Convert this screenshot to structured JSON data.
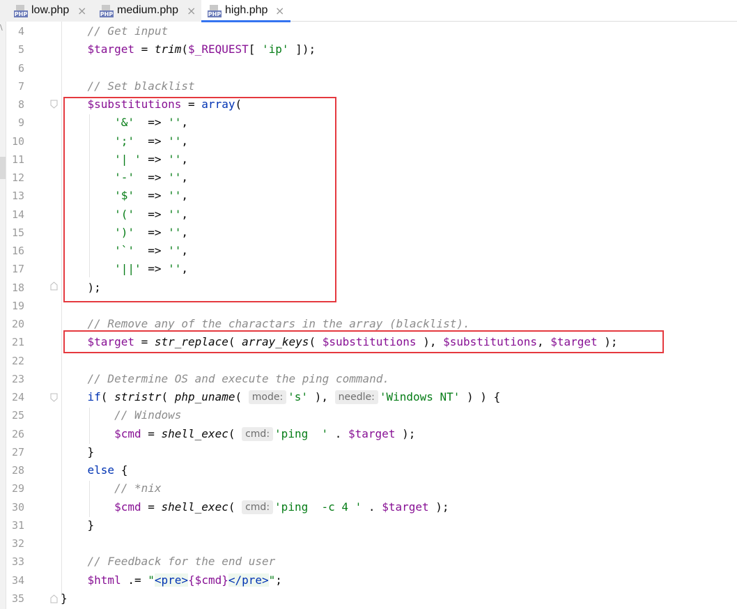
{
  "tabs": [
    {
      "label": "low.php",
      "icon": "php-file-icon",
      "active": false
    },
    {
      "label": "medium.php",
      "icon": "php-file-icon",
      "active": false
    },
    {
      "label": "high.php",
      "icon": "php-file-icon",
      "active": true
    }
  ],
  "php_icon_text": "PHP",
  "close_glyph": "×",
  "gutter_corner_text": "\\",
  "line_numbers": [
    "4",
    "5",
    "6",
    "7",
    "8",
    "9",
    "10",
    "11",
    "12",
    "13",
    "14",
    "15",
    "16",
    "17",
    "18",
    "19",
    "20",
    "21",
    "22",
    "23",
    "24",
    "25",
    "26",
    "27",
    "28",
    "29",
    "30",
    "31",
    "32",
    "33",
    "34",
    "35"
  ],
  "code": {
    "l4_comment": "// Get input",
    "l5": {
      "var": "$target",
      "op": " = ",
      "fn": "trim",
      "open": "(",
      "arg": "$_REQUEST",
      "br": "[ ",
      "str": "'ip'",
      "close": " ]);"
    },
    "l7_comment": "// Set blacklist",
    "l8": {
      "var": "$substitutions",
      "op": " = ",
      "kw": "array",
      "open": "("
    },
    "blacklist": [
      {
        "key": "'&'",
        "pad": "  ",
        "arrow": "=> ",
        "val": "''",
        "end": ","
      },
      {
        "key": "';'",
        "pad": "  ",
        "arrow": "=> ",
        "val": "''",
        "end": ","
      },
      {
        "key": "'| '",
        "pad": " ",
        "arrow": "=> ",
        "val": "''",
        "end": ","
      },
      {
        "key": "'-'",
        "pad": "  ",
        "arrow": "=> ",
        "val": "''",
        "end": ","
      },
      {
        "key": "'$'",
        "pad": "  ",
        "arrow": "=> ",
        "val": "''",
        "end": ","
      },
      {
        "key": "'('",
        "pad": "  ",
        "arrow": "=> ",
        "val": "''",
        "end": ","
      },
      {
        "key": "')'",
        "pad": "  ",
        "arrow": "=> ",
        "val": "''",
        "end": ","
      },
      {
        "key": "'`'",
        "pad": "  ",
        "arrow": "=> ",
        "val": "''",
        "end": ","
      },
      {
        "key": "'||'",
        "pad": " ",
        "arrow": "=> ",
        "val": "''",
        "end": ","
      }
    ],
    "l18": ");",
    "l20_comment": "// Remove any of the charactars in the array (blacklist).",
    "l21": {
      "var1": "$target",
      "op": " = ",
      "fn1": "str_replace",
      "p1": "( ",
      "fn2": "array_keys",
      "p2": "( ",
      "var2": "$substitutions",
      "p3": " ), ",
      "var3": "$substitutions",
      "comma": ", ",
      "var4": "$target",
      "close": " );"
    },
    "l23_comment": "// Determine OS and execute the ping command.",
    "l24": {
      "kw": "if",
      "p1": "( ",
      "fn1": "stristr",
      "p2": "( ",
      "fn2": "php_uname",
      "p3": "( ",
      "hint1": "mode:",
      "str1": "'s'",
      "p4": " ), ",
      "hint2": "needle:",
      "str2": "'Windows NT'",
      "close": " ) ) {"
    },
    "l25_comment": "// Windows",
    "l26": {
      "var": "$cmd",
      "op": " = ",
      "fn": "shell_exec",
      "p1": "( ",
      "hint": "cmd:",
      "str": "'ping  '",
      "dot": " . ",
      "var2": "$target",
      "close": " );"
    },
    "l27": "}",
    "l28": {
      "kw": "else",
      "rest": " {"
    },
    "l29_comment": "// *nix",
    "l30": {
      "var": "$cmd",
      "op": " = ",
      "fn": "shell_exec",
      "p1": "( ",
      "hint": "cmd:",
      "str": "'ping  -c 4 '",
      "dot": " . ",
      "var2": "$target",
      "close": " );"
    },
    "l31": "}",
    "l33_comment": "// Feedback for the end user",
    "l34": {
      "var": "$html",
      "op": " .= ",
      "q1": "\"",
      "tag1": "<pre>",
      "interp": "{$cmd}",
      "tag2": "</pre>",
      "q2": "\"",
      "end": ";"
    },
    "l35": "}"
  },
  "colors": {
    "variable": "#871094",
    "keyword": "#0033b3",
    "string": "#067d17",
    "comment": "#8c8c8c",
    "highlight_box": "#e5393f",
    "active_tab_underline": "#3574f0"
  }
}
